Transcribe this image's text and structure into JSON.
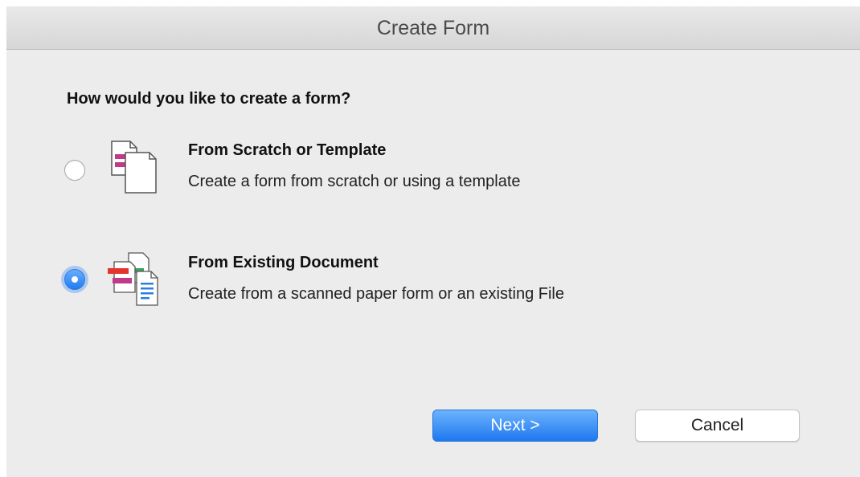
{
  "window": {
    "title": "Create Form"
  },
  "prompt": {
    "question": "How would you like to create a form?"
  },
  "options": [
    {
      "title": "From Scratch or Template",
      "description": "Create a form from scratch or using a template",
      "icon": "blank-form-icon",
      "selected": false
    },
    {
      "title": "From Existing Document",
      "description": "Create from a scanned paper form or an existing File",
      "icon": "existing-documents-icon",
      "selected": true
    }
  ],
  "buttons": {
    "next_label": "Next >",
    "cancel_label": "Cancel"
  },
  "colors": {
    "accent": "#1f7cf0",
    "dialog_bg": "#ececec"
  }
}
